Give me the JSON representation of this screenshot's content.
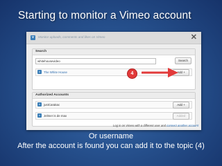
{
  "slide": {
    "title": "Starting to monitor a Vimeo account",
    "caption_line1": "Or username",
    "caption_line2": "After the account is found you can add it to the topic (4)"
  },
  "dialog": {
    "header_label": "Monitor uploads, comments and likes on Vimeo",
    "close_glyph": "✕",
    "search": {
      "section_title": "Search",
      "input_value": "whitehousevideo",
      "search_button": "Search",
      "result": {
        "name": "The White House",
        "add_button": "Add +"
      }
    },
    "authorized": {
      "section_title": "Authorized Accounts",
      "accounts": [
        {
          "name": "justCarakac",
          "button": "Add +",
          "disabled": false
        },
        {
          "name": "Jelmer is de max",
          "button": "Added",
          "disabled": true
        }
      ]
    },
    "footer": {
      "text": "Log in on Vimeo with a different user and ",
      "link": "connect another account"
    }
  },
  "annotation": {
    "step_number": "4",
    "color": "#e23a3a"
  },
  "colors": {
    "vimeo_blue": "#3c7fb8",
    "link": "#2d6db0",
    "background": "#27528f"
  }
}
